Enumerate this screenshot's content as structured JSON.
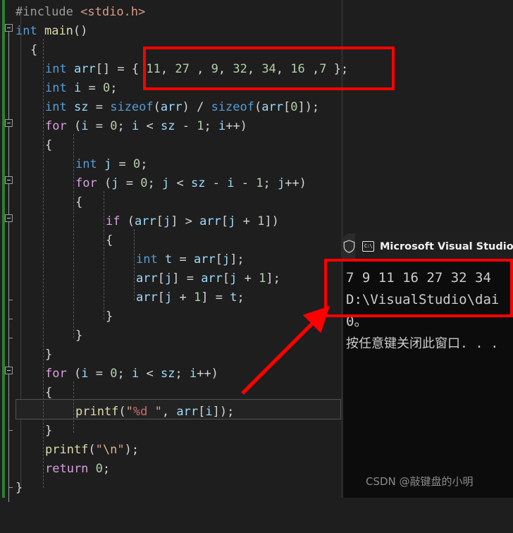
{
  "editor": {
    "language": "c",
    "theme": "dark",
    "code_lines": [
      "#include <stdio.h>",
      "int main()",
      "{",
      "    int arr[] = { 11, 27 , 9, 32, 34, 16 ,7 };",
      "    int i = 0;",
      "    int sz = sizeof(arr) / sizeof(arr[0]);",
      "    for (i = 0; i < sz - 1; i++)",
      "    {",
      "        int j = 0;",
      "        for (j = 0; j < sz - i - 1; j++)",
      "        {",
      "            if (arr[j] > arr[j + 1])",
      "            {",
      "                int t = arr[j];",
      "                arr[j] = arr[j + 1];",
      "                arr[j + 1] = t;",
      "            }",
      "        }",
      "    }",
      "    for (i = 0; i < sz; i++)",
      "    {",
      "        printf(\"%d \", arr[i]);",
      "    }",
      "    printf(\"\\n\");",
      "    return 0;",
      "}"
    ],
    "array_literal": {
      "declaration": "int arr[] = { 11, 27 , 9, 32, 34, 16 ,7 };",
      "values": [
        11,
        27,
        9,
        32,
        34,
        16,
        7
      ]
    },
    "current_line_text": "printf(\"%d \", arr[i]);",
    "colors": {
      "background": "#1e1e1e",
      "keyword": "#569cd6",
      "control": "#d8a0df",
      "identifier": "#9cdcfe",
      "function": "#dcdcaa",
      "number": "#b5cea8",
      "string": "#d69d85",
      "operator": "#d4d4d4",
      "preprocessor": "#9b9b9b",
      "change_bar": "#2e7d32"
    }
  },
  "console": {
    "title": "Microsoft Visual Studio",
    "icons": {
      "shield": "shield-icon",
      "terminal": "cmd-icon",
      "terminal_glyph": "C:\\"
    },
    "output_lines": [
      "7 9 11 16 27 32 34",
      "D:\\VisualStudio\\dai",
      " 0。",
      "按任意键关闭此窗口. . ."
    ],
    "sorted_result": [
      7,
      9,
      11,
      16,
      27,
      32,
      34
    ]
  },
  "annotations": {
    "highlight_color": "#ff0000",
    "boxes": [
      {
        "name": "array-literal-highlight",
        "target": "int arr[] = { 11, 27 , 9, 32, 34, 16 ,7 };"
      },
      {
        "name": "sorted-output-highlight",
        "target": "7 9 11 16 27 32 34"
      }
    ],
    "arrow": {
      "name": "output-arrow",
      "from": "editor",
      "to": "console-output"
    }
  },
  "watermark": {
    "text": "CSDN @敲键盘的小明"
  }
}
